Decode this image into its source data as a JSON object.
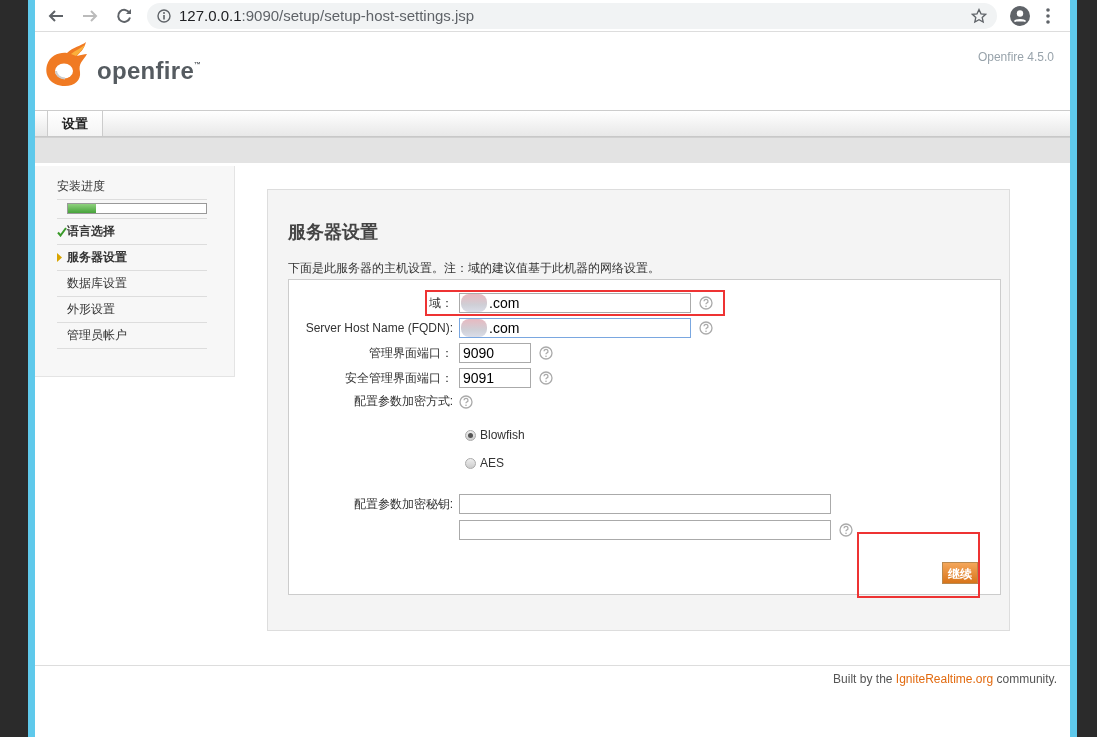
{
  "browser": {
    "url": "127.0.0.1:9090/setup/setup-host-settings.jsp"
  },
  "header": {
    "logo_text": "openfire",
    "trademark": "™",
    "version": "Openfire 4.5.0"
  },
  "tabs": [
    {
      "label": "设置",
      "selected": true
    }
  ],
  "sidebar": {
    "title": "安装进度",
    "progress": {
      "level": 0.2
    },
    "steps": [
      {
        "label": "语言选择",
        "kind": "done"
      },
      {
        "label": "服务器设置",
        "kind": "current"
      },
      {
        "label": "数据库设置",
        "kind": "pending"
      },
      {
        "label": "外形设置",
        "kind": "pending"
      },
      {
        "label": "管理员帐户",
        "kind": "pending"
      }
    ]
  },
  "form": {
    "title": "服务器设置",
    "description": "下面是此服务器的主机设置。注：域的建议值基于此机器的网络设置。",
    "fields": [
      {
        "kind": "host",
        "label": "域：",
        "value": ".com",
        "help": true,
        "highlighted": true,
        "focused": false,
        "redacted": true
      },
      {
        "kind": "host",
        "label": "Server Host Name (FQDN):",
        "value": ".com",
        "help": true,
        "highlighted": false,
        "focused": true,
        "redacted": true
      },
      {
        "kind": "port",
        "label": "管理界面端口：",
        "value": "9090",
        "help": true,
        "highlighted": false,
        "focused": false,
        "redacted": false
      },
      {
        "kind": "port",
        "label": "安全管理界面端口：",
        "value": "9091",
        "help": true,
        "highlighted": false,
        "focused": false,
        "redacted": false
      },
      {
        "kind": "radio",
        "label": "配置参数加密方式:",
        "help": true,
        "options": [
          {
            "label": "Blowfish",
            "selected": true
          },
          {
            "label": "AES",
            "selected": false
          }
        ]
      },
      {
        "kind": "key-pair",
        "label": "配置参数加密秘钥:",
        "help": true
      }
    ],
    "continue_button": {
      "label": "继续",
      "highlighted": true
    }
  },
  "footer": {
    "prefix": "Built by the ",
    "link": "IgniteRealtime.org",
    "suffix": " community."
  }
}
